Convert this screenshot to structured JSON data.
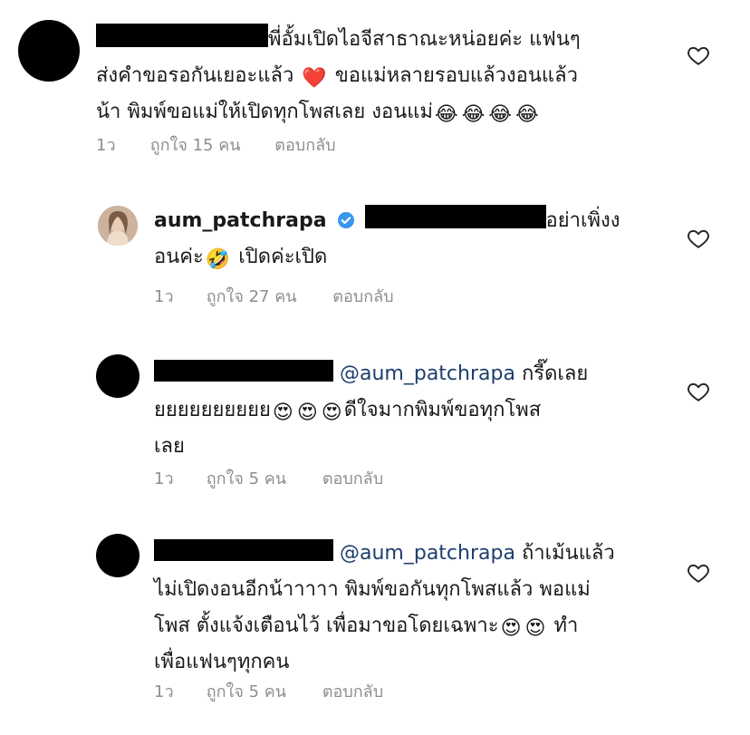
{
  "comments": [
    {
      "text_lines": [
        "พี่อั้มเปิดไอจีสาธาณะหน่อยค่ะ แฟนๆ",
        "ส่งคำขอรอกันเยอะแล้ว",
        "ขอแม่หลายรอบแล้วงอนแล้ว",
        "น้า พิมพ์ขอแม่ให้เปิดทุกโพสเลย งอนแม่"
      ],
      "emoji_heart": "❤️",
      "emoji_laugh": "😂",
      "time": "1ว",
      "likes": "ถูกใจ 15 คน",
      "reply": "ตอบกลับ"
    },
    {
      "username": "aum_patchrapa",
      "text_line1": "อย่าเพิ่งง",
      "text_line2a": "อนค่ะ",
      "emoji_rofl": "🤣",
      "text_line2b": "เปิดค่ะเปิด",
      "time": "1ว",
      "likes": "ถูกใจ 27 คน",
      "reply": "ตอบกลับ"
    },
    {
      "mention": "@aum_patchrapa",
      "text_line1": "กรี๊ดเลย",
      "text_line2a": "ยยยยยยยยยย",
      "emoji_hearteyes": "😍",
      "text_line2b": "ดีใจมากพิมพ์ขอทุกโพส",
      "text_line3": "เลย",
      "time": "1ว",
      "likes": "ถูกใจ 5 คน",
      "reply": "ตอบกลับ"
    },
    {
      "mention": "@aum_patchrapa",
      "text_line1": "ถ้าเม้นแล้ว",
      "text_line2": "ไม่เปิดงอนอีกน้าาาาา พิมพ์ขอกันทุกโพสแล้ว พอแม่",
      "text_line3a": "โพส ตั้งแจ้งเตือนไว้ เพื่อมาขอโดยเฉพาะ",
      "emoji_hearteyes": "😍",
      "text_line3b": "ทำ",
      "text_line4": "เพื่อแฟนๆทุกคน",
      "time": "1ว",
      "likes": "ถูกใจ 5 คน",
      "reply": "ตอบกลับ"
    }
  ]
}
